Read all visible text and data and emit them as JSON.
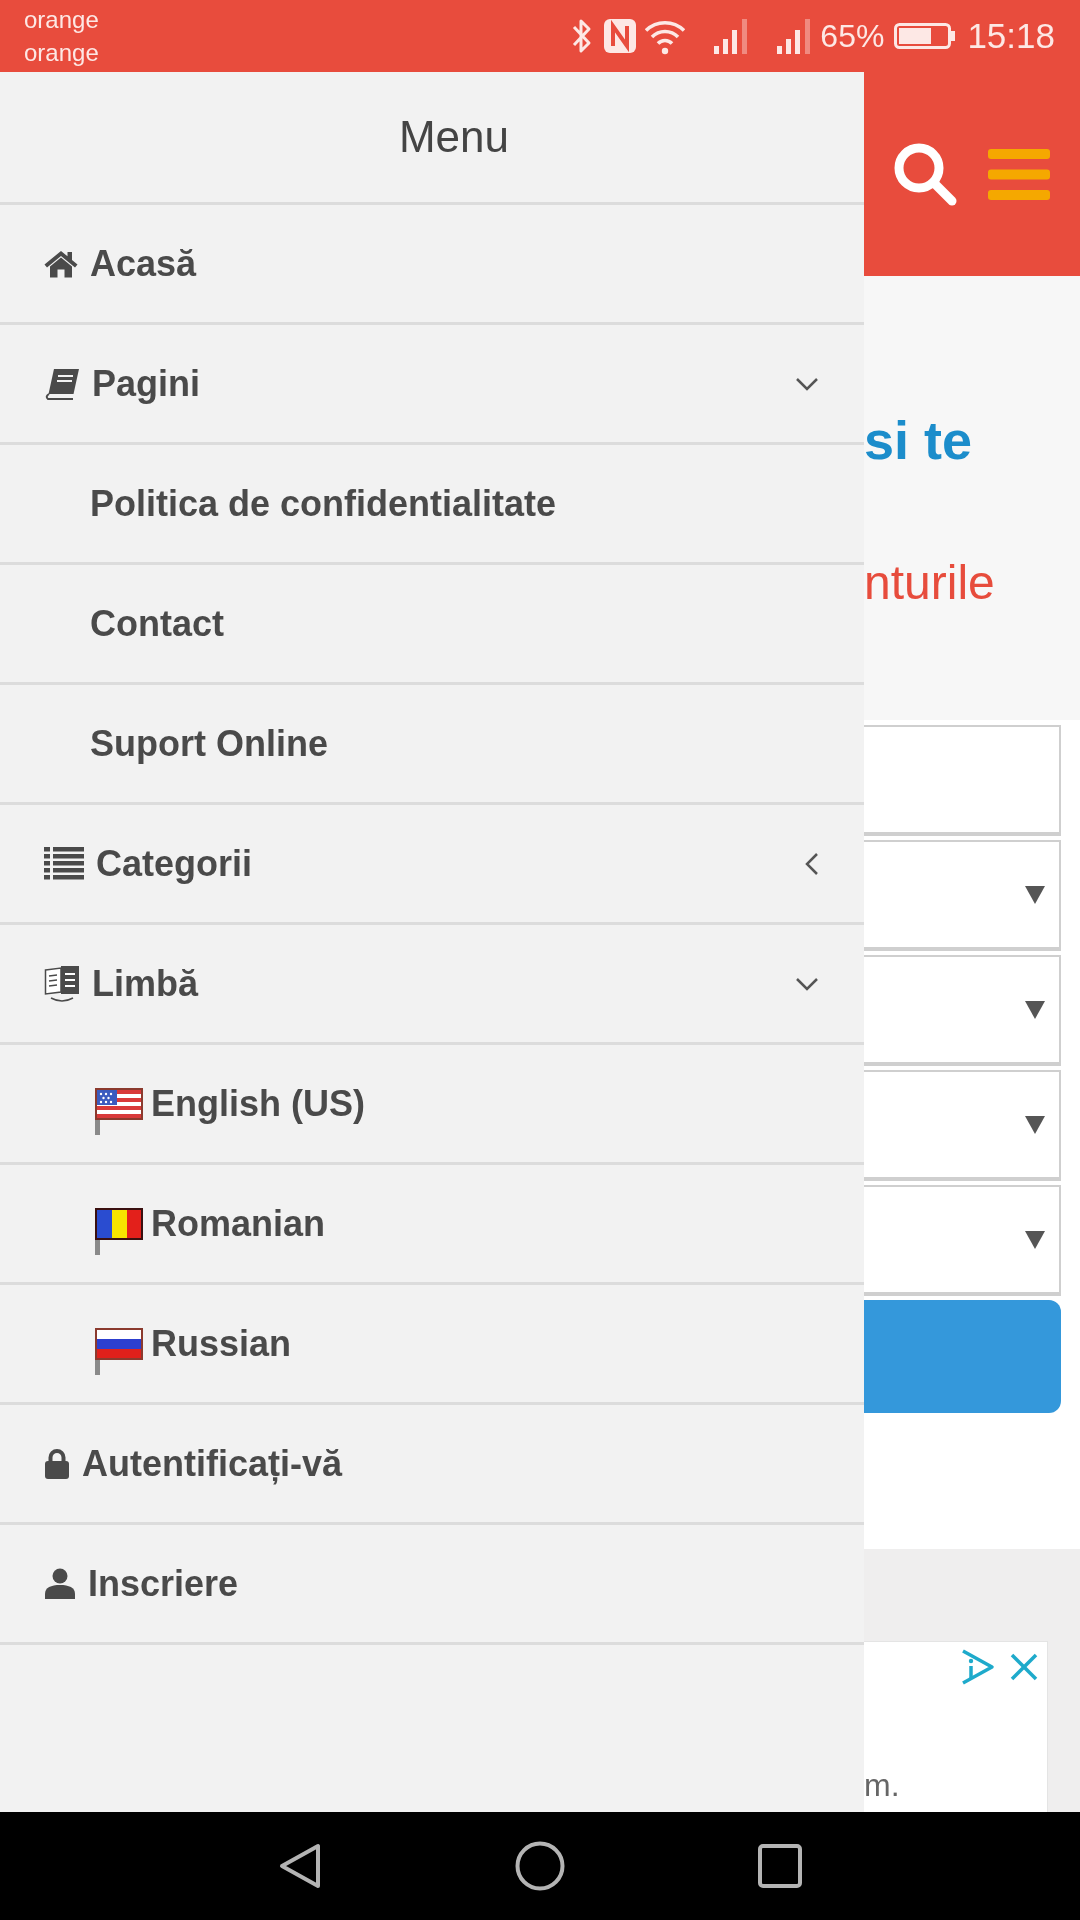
{
  "status_bar": {
    "carriers": [
      "orange",
      "orange"
    ],
    "battery": "65%",
    "time": "15:18"
  },
  "menu": {
    "title": "Menu",
    "items": [
      {
        "label": "Acasă",
        "kind": "link"
      },
      {
        "label": "Pagini",
        "kind": "group",
        "expanded": true,
        "children": [
          {
            "label": "Politica de confidentialitate"
          },
          {
            "label": "Contact"
          },
          {
            "label": "Suport Online"
          }
        ]
      },
      {
        "label": "Categorii",
        "kind": "group",
        "expanded": false
      },
      {
        "label": "Limbă",
        "kind": "group",
        "expanded": true,
        "children": [
          {
            "label": "English (US)"
          },
          {
            "label": "Romanian"
          },
          {
            "label": "Russian"
          }
        ]
      },
      {
        "label": "Autentificați-vă",
        "kind": "link"
      },
      {
        "label": "Inscriere",
        "kind": "link"
      }
    ]
  },
  "page": {
    "heading": "si te",
    "subheading": "nturile",
    "fields": [
      {
        "kind": "text"
      },
      {
        "kind": "select"
      },
      {
        "kind": "select"
      },
      {
        "kind": "select"
      },
      {
        "kind": "select"
      }
    ],
    "ad": {
      "text": "m."
    }
  }
}
